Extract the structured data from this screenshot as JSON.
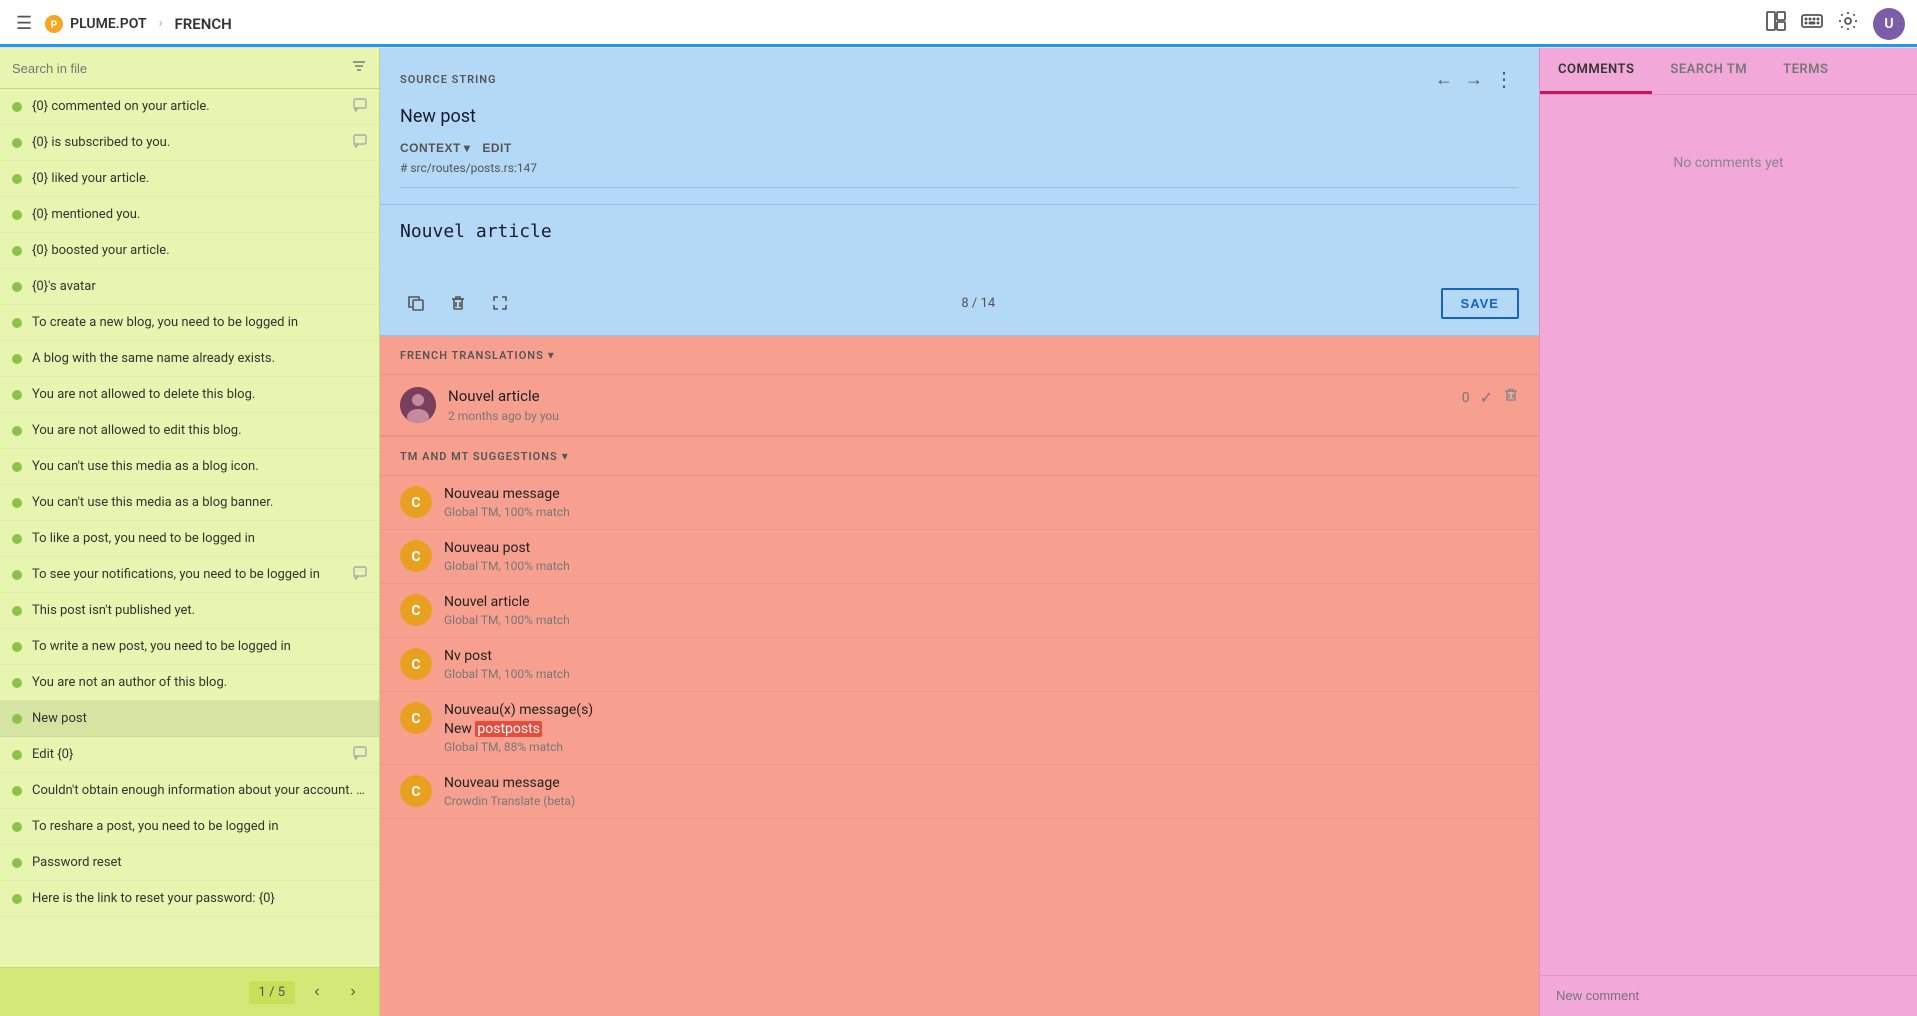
{
  "topbar": {
    "menu_label": "☰",
    "logo_text": "PLUME.POT",
    "separator": "›",
    "project": "FRENCH",
    "icons": {
      "layout": "⊞",
      "keyboard": "⌨",
      "settings": "⚙"
    },
    "avatar_initials": "U"
  },
  "sidebar": {
    "search_placeholder": "Search in file",
    "filter_icon": "≡",
    "items": [
      {
        "id": 1,
        "text": "{0} commented on your article.",
        "has_icon": true
      },
      {
        "id": 2,
        "text": "{0} is subscribed to you.",
        "has_icon": true
      },
      {
        "id": 3,
        "text": "{0} liked your article.",
        "has_icon": false
      },
      {
        "id": 4,
        "text": "{0} mentioned you.",
        "has_icon": false
      },
      {
        "id": 5,
        "text": "{0} boosted your article.",
        "has_icon": false
      },
      {
        "id": 6,
        "text": "{0}'s avatar",
        "has_icon": false
      },
      {
        "id": 7,
        "text": "To create a new blog, you need to be logged in",
        "has_icon": false
      },
      {
        "id": 8,
        "text": "A blog with the same name already exists.",
        "has_icon": false
      },
      {
        "id": 9,
        "text": "You are not allowed to delete this blog.",
        "has_icon": false
      },
      {
        "id": 10,
        "text": "You are not allowed to edit this blog.",
        "has_icon": false
      },
      {
        "id": 11,
        "text": "You can't use this media as a blog icon.",
        "has_icon": false
      },
      {
        "id": 12,
        "text": "You can't use this media as a blog banner.",
        "has_icon": false
      },
      {
        "id": 13,
        "text": "To like a post, you need to be logged in",
        "has_icon": false
      },
      {
        "id": 14,
        "text": "To see your notifications, you need to be logged in",
        "has_icon": true
      },
      {
        "id": 15,
        "text": "This post isn't published yet.",
        "has_icon": false
      },
      {
        "id": 16,
        "text": "To write a new post, you need to be logged in",
        "has_icon": false
      },
      {
        "id": 17,
        "text": "You are not an author of this blog.",
        "has_icon": false
      },
      {
        "id": 18,
        "text": "New post",
        "has_icon": false,
        "active": true
      },
      {
        "id": 19,
        "text": "Edit {0}",
        "has_icon": true
      },
      {
        "id": 20,
        "text": "Couldn't obtain enough information about your account. Please m...",
        "has_icon": false
      },
      {
        "id": 21,
        "text": "To reshare a post, you need to be logged in",
        "has_icon": false
      },
      {
        "id": 22,
        "text": "Password reset",
        "has_icon": false
      },
      {
        "id": 23,
        "text": "Here is the link to reset your password: {0}",
        "has_icon": false
      }
    ],
    "pagination": {
      "current": "1",
      "total": "5",
      "prev_icon": "‹",
      "next_icon": "›"
    }
  },
  "source_string": {
    "label": "SOURCE STRING",
    "text": "New post",
    "context_label": "CONTEXT",
    "edit_label": "EDIT",
    "context_path": "# src/routes/posts.rs:147",
    "nav_prev": "←",
    "nav_next": "→",
    "more": "⋮"
  },
  "translation": {
    "text": "Nouvel article",
    "char_count": "8 / 14",
    "save_label": "SAVE",
    "icons": {
      "copy": "⧉",
      "delete": "🗑",
      "expand": "⛶"
    }
  },
  "french_translations": {
    "label": "FRENCH TRANSLATIONS",
    "items": [
      {
        "text": "Nouvel article",
        "meta": "2 months ago by you",
        "votes": "0"
      }
    ]
  },
  "suggestions": {
    "label": "TM AND MT SUGGESTIONS",
    "items": [
      {
        "text": "Nouveau message",
        "meta": "Global TM, 100% match",
        "has_highlight": false
      },
      {
        "text": "Nouveau post",
        "meta": "Global TM, 100% match",
        "has_highlight": false
      },
      {
        "text": "Nouvel article",
        "meta": "Global TM, 100% match",
        "has_highlight": false
      },
      {
        "text": "Nv post",
        "meta": "Global TM, 100% match",
        "has_highlight": false
      },
      {
        "text_before": "Nouveau(x) message(s)",
        "text_sub1": "New ",
        "text_highlight": "postposts",
        "meta": "Global TM, 88% match",
        "has_highlight": true
      },
      {
        "text": "Nouveau message",
        "meta": "Crowdin Translate (beta)",
        "has_highlight": false
      }
    ]
  },
  "right_panel": {
    "tabs": [
      {
        "id": "comments",
        "label": "COMMENTS",
        "active": true
      },
      {
        "id": "search_tm",
        "label": "SEARCH TM",
        "active": false
      },
      {
        "id": "terms",
        "label": "TERMS",
        "active": false
      }
    ],
    "no_comments_text": "No comments yet",
    "new_comment_placeholder": "New comment"
  }
}
